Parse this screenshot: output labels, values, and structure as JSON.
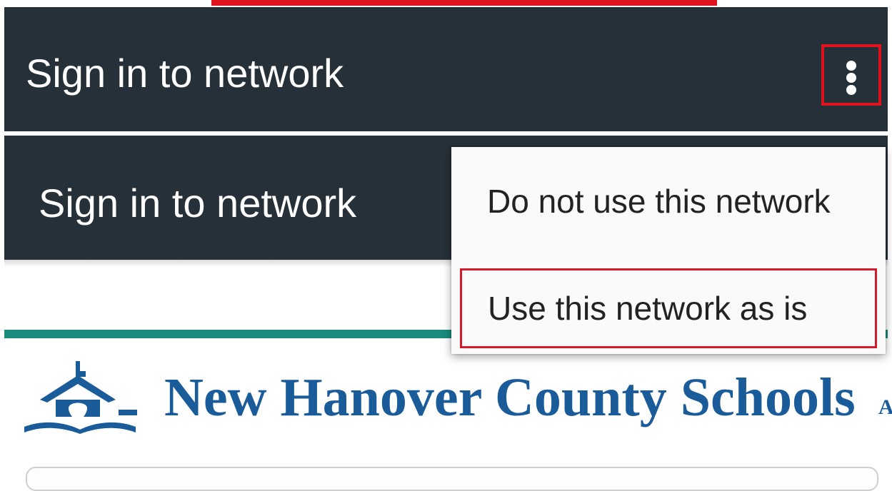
{
  "app_bar_title": "Sign in to network",
  "menu": {
    "items": [
      {
        "label": "Do not use this network",
        "highlighted": false
      },
      {
        "label": "Use this network as is",
        "highlighted": true
      }
    ]
  },
  "page": {
    "school_name": "New Hanover County Schools",
    "edge_text": "A"
  },
  "icons": {
    "overflow": "more-vert-icon",
    "logo": "schoolhouse-logo-icon"
  },
  "colors": {
    "appbar_bg": "#263038",
    "highlight_border": "#d31b2a",
    "teal_accent": "#1a8b7c",
    "school_blue": "#1a5b9a"
  }
}
